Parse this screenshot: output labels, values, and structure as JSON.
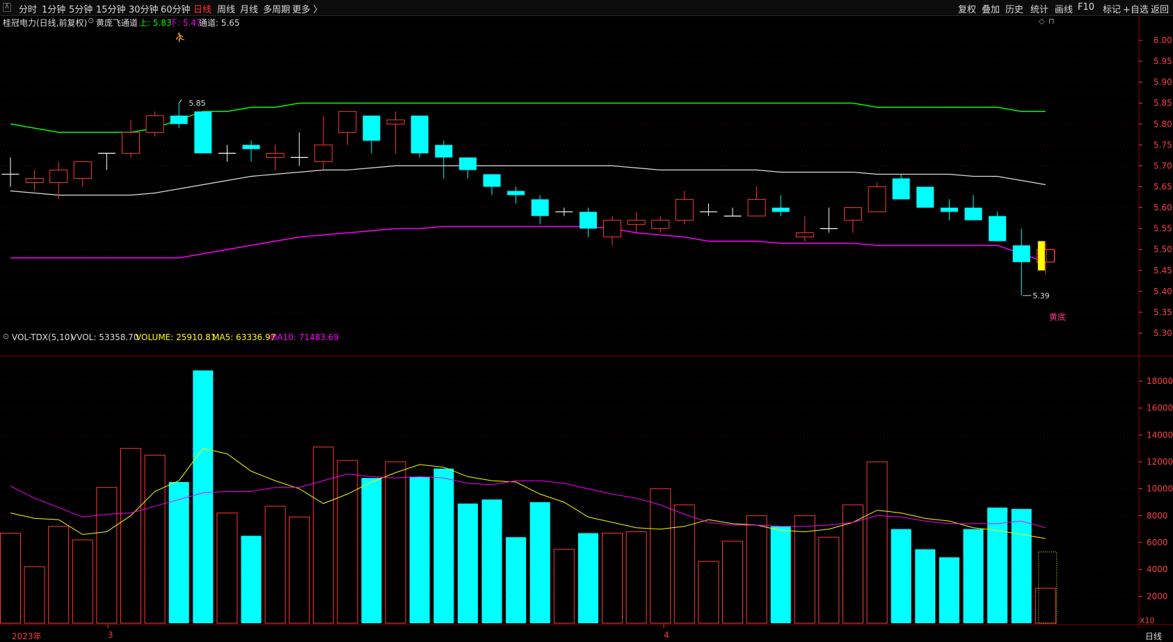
{
  "toolbar": {
    "left_items": [
      "分时",
      "1分钟",
      "5分钟",
      "15分钟",
      "30分钟",
      "60分钟",
      "日线",
      "周线",
      "月线",
      "多周期",
      "更多 〉"
    ],
    "active_index": 6,
    "right_items": [
      "复权",
      "叠加",
      "历史",
      "统计",
      "画线",
      "F10",
      "标记",
      "+自选",
      "返回"
    ]
  },
  "main_header": {
    "stock": "桂冠电力(日线,前复权)",
    "indicator": "黄庞飞通道",
    "upper_label": "上: 5.83",
    "lower_label": "下: 5.47",
    "channel_label": "通道: 5.65"
  },
  "vol_header": {
    "name": "VOL-TDX(5,10)",
    "vvol": "VVOL: 53358.70",
    "volume": "VOLUME: 25910.81",
    "ma5": "MA5: 63336.97",
    "ma10": "MA10: 71483.69"
  },
  "annotations": {
    "high": "5.85",
    "low": "5.39",
    "signal": "黄底",
    "multiplier": "X10"
  },
  "x_axis": {
    "labels": [
      "2023年",
      "3",
      "4"
    ],
    "period": "日线"
  },
  "colors": {
    "up": "#ff3a3a",
    "down": "#00ffff",
    "upper_band": "#00ff00",
    "mid_band": "#e0e0e0",
    "lower_band": "#ff00ff",
    "ma5": "#ffff00",
    "ma10": "#ff00ff",
    "grid": "#8b0000"
  },
  "chart_data": [
    {
      "type": "candlestick",
      "title": "桂冠电力(日线,前复权)",
      "y_ticks": [
        6.0,
        5.95,
        5.9,
        5.85,
        5.8,
        5.75,
        5.7,
        5.65,
        5.6,
        5.55,
        5.5,
        5.45,
        5.4,
        5.35,
        5.3
      ],
      "ohlc": [
        [
          5.68,
          5.72,
          5.65,
          5.68
        ],
        [
          5.66,
          5.69,
          5.64,
          5.67
        ],
        [
          5.66,
          5.71,
          5.62,
          5.69
        ],
        [
          5.67,
          5.71,
          5.65,
          5.71
        ],
        [
          5.73,
          5.73,
          5.69,
          5.73
        ],
        [
          5.73,
          5.81,
          5.72,
          5.78
        ],
        [
          5.78,
          5.83,
          5.77,
          5.82
        ],
        [
          5.82,
          5.85,
          5.79,
          5.8
        ],
        [
          5.83,
          5.83,
          5.73,
          5.73
        ],
        [
          5.73,
          5.75,
          5.71,
          5.73
        ],
        [
          5.75,
          5.76,
          5.71,
          5.74
        ],
        [
          5.72,
          5.75,
          5.69,
          5.73
        ],
        [
          5.72,
          5.78,
          5.7,
          5.72
        ],
        [
          5.71,
          5.82,
          5.69,
          5.75
        ],
        [
          5.78,
          5.83,
          5.75,
          5.83
        ],
        [
          5.82,
          5.82,
          5.73,
          5.76
        ],
        [
          5.8,
          5.83,
          5.73,
          5.81
        ],
        [
          5.82,
          5.82,
          5.72,
          5.73
        ],
        [
          5.75,
          5.76,
          5.67,
          5.72
        ],
        [
          5.72,
          5.72,
          5.67,
          5.69
        ],
        [
          5.68,
          5.68,
          5.63,
          5.65
        ],
        [
          5.64,
          5.65,
          5.61,
          5.63
        ],
        [
          5.62,
          5.63,
          5.56,
          5.58
        ],
        [
          5.59,
          5.6,
          5.58,
          5.59
        ],
        [
          5.59,
          5.6,
          5.53,
          5.55
        ],
        [
          5.53,
          5.58,
          5.51,
          5.57
        ],
        [
          5.56,
          5.59,
          5.54,
          5.57
        ],
        [
          5.55,
          5.58,
          5.54,
          5.57
        ],
        [
          5.57,
          5.64,
          5.56,
          5.62
        ],
        [
          5.59,
          5.61,
          5.58,
          5.59
        ],
        [
          5.58,
          5.6,
          5.58,
          5.58
        ],
        [
          5.58,
          5.65,
          5.58,
          5.62
        ],
        [
          5.6,
          5.63,
          5.58,
          5.59
        ],
        [
          5.53,
          5.58,
          5.52,
          5.54
        ],
        [
          5.55,
          5.6,
          5.54,
          5.55
        ],
        [
          5.57,
          5.6,
          5.54,
          5.6
        ],
        [
          5.59,
          5.66,
          5.59,
          5.65
        ],
        [
          5.67,
          5.68,
          5.62,
          5.62
        ],
        [
          5.65,
          5.65,
          5.6,
          5.6
        ],
        [
          5.6,
          5.62,
          5.57,
          5.59
        ],
        [
          5.6,
          5.63,
          5.57,
          5.57
        ],
        [
          5.58,
          5.59,
          5.52,
          5.52
        ],
        [
          5.51,
          5.55,
          5.39,
          5.47
        ],
        [
          5.47,
          5.52,
          5.44,
          5.5
        ]
      ],
      "last_bar_highlight_color": "#ffff00",
      "upper_band": [
        5.8,
        5.79,
        5.78,
        5.78,
        5.78,
        5.78,
        5.79,
        5.81,
        5.83,
        5.83,
        5.84,
        5.84,
        5.85,
        5.85,
        5.85,
        5.85,
        5.85,
        5.85,
        5.85,
        5.85,
        5.85,
        5.85,
        5.85,
        5.85,
        5.85,
        5.85,
        5.85,
        5.85,
        5.85,
        5.85,
        5.85,
        5.85,
        5.85,
        5.85,
        5.85,
        5.85,
        5.84,
        5.84,
        5.84,
        5.84,
        5.84,
        5.84,
        5.83,
        5.83
      ],
      "mid_band": [
        5.64,
        5.635,
        5.63,
        5.63,
        5.63,
        5.63,
        5.635,
        5.645,
        5.655,
        5.665,
        5.675,
        5.68,
        5.685,
        5.69,
        5.69,
        5.695,
        5.7,
        5.7,
        5.7,
        5.7,
        5.7,
        5.7,
        5.7,
        5.7,
        5.7,
        5.7,
        5.695,
        5.69,
        5.69,
        5.69,
        5.69,
        5.69,
        5.685,
        5.685,
        5.685,
        5.685,
        5.68,
        5.68,
        5.68,
        5.68,
        5.675,
        5.675,
        5.665,
        5.655
      ],
      "lower_band": [
        5.48,
        5.48,
        5.48,
        5.48,
        5.48,
        5.48,
        5.48,
        5.48,
        5.49,
        5.5,
        5.51,
        5.52,
        5.53,
        5.535,
        5.54,
        5.545,
        5.55,
        5.55,
        5.555,
        5.555,
        5.555,
        5.555,
        5.555,
        5.555,
        5.555,
        5.55,
        5.54,
        5.535,
        5.53,
        5.52,
        5.52,
        5.52,
        5.515,
        5.515,
        5.515,
        5.515,
        5.51,
        5.51,
        5.51,
        5.51,
        5.51,
        5.51,
        5.49,
        5.47
      ]
    },
    {
      "type": "bar",
      "title": "VOL-TDX(5,10)",
      "y_ticks": [
        18000,
        16000,
        14000,
        12000,
        10000,
        8000,
        6000,
        4000,
        2000
      ],
      "volumes": [
        6700,
        4200,
        7200,
        6200,
        10100,
        13000,
        12500,
        10500,
        18800,
        8200,
        6500,
        8700,
        7900,
        13100,
        12100,
        10800,
        12000,
        10900,
        11500,
        8900,
        9200,
        6400,
        9000,
        5500,
        6700,
        6700,
        6800,
        10000,
        8800,
        4600,
        6100,
        8000,
        7200,
        8000,
        6400,
        8800,
        12000,
        7000,
        5500,
        4900,
        7000,
        8600,
        8500,
        2600
      ],
      "ma5": [
        8200,
        7800,
        7700,
        6600,
        6800,
        8000,
        9800,
        10600,
        13000,
        12600,
        11300,
        10600,
        10000,
        8900,
        9600,
        10500,
        11200,
        11800,
        11600,
        10900,
        10600,
        10500,
        9600,
        9000,
        7900,
        7500,
        7100,
        7000,
        7200,
        7700,
        7400,
        7300,
        6900,
        6800,
        7000,
        7500,
        8400,
        8200,
        7800,
        7600,
        7100,
        6900,
        6600,
        6300
      ],
      "ma10": [
        10200,
        9300,
        8600,
        7900,
        8100,
        8200,
        8700,
        9200,
        9700,
        9800,
        9800,
        10100,
        10100,
        10600,
        11100,
        10900,
        10800,
        10900,
        10800,
        10400,
        10300,
        10600,
        10600,
        10400,
        10000,
        9600,
        9300,
        8800,
        8100,
        7500,
        7300,
        7300,
        7200,
        7200,
        7300,
        7500,
        8000,
        7900,
        7600,
        7400,
        7400,
        7400,
        7600,
        7100
      ],
      "future_volume": 5300
    }
  ]
}
